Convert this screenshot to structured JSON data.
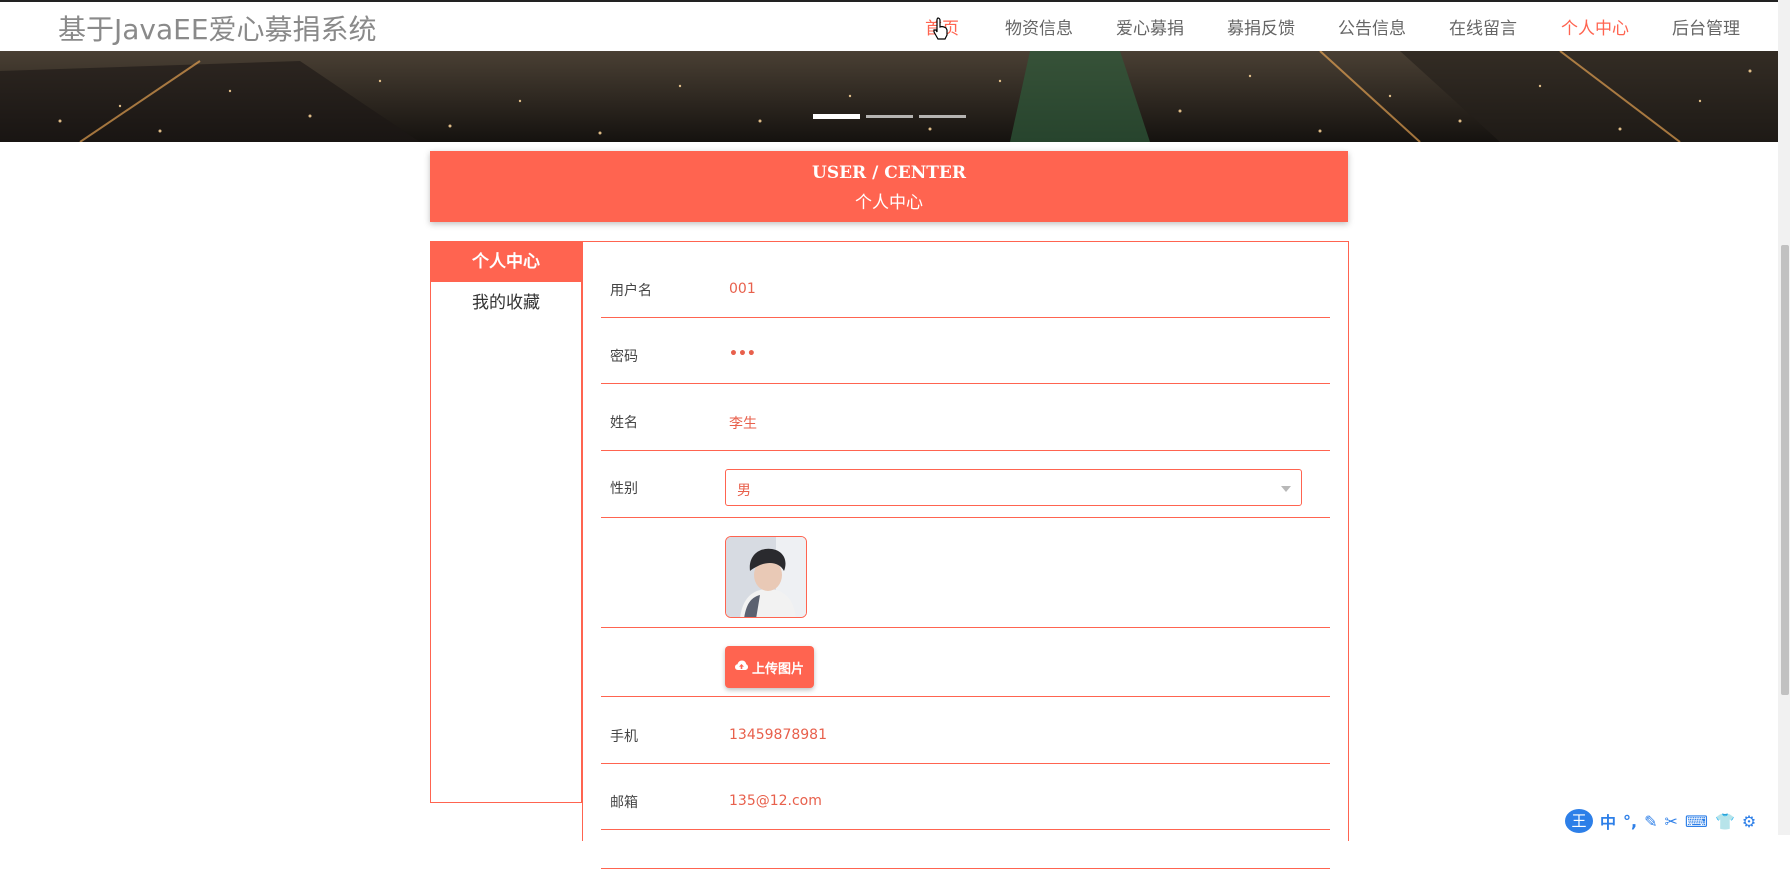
{
  "site_title": "基于JavaEE爱心募捐系统",
  "nav": [
    {
      "label": "首页"
    },
    {
      "label": "物资信息"
    },
    {
      "label": "爱心募捐"
    },
    {
      "label": "募捐反馈"
    },
    {
      "label": "公告信息"
    },
    {
      "label": "在线留言"
    },
    {
      "label": "个人中心"
    },
    {
      "label": "后台管理"
    }
  ],
  "header": {
    "en": "USER / CENTER",
    "cn": "个人中心"
  },
  "sidebar": [
    {
      "label": "个人中心"
    },
    {
      "label": "我的收藏"
    }
  ],
  "form": {
    "username": {
      "label": "用户名",
      "value": "001"
    },
    "password": {
      "label": "密码",
      "value": "•••"
    },
    "name": {
      "label": "姓名",
      "value": "李生"
    },
    "gender": {
      "label": "性别",
      "value": "男"
    },
    "upload_label": "上传图片",
    "phone": {
      "label": "手机",
      "value": "13459878981"
    },
    "email": {
      "label": "邮箱",
      "value": "135@12.com"
    }
  },
  "ime": {
    "logo": "王",
    "items": [
      "中",
      "°,",
      "✎",
      "✂",
      "⌨",
      "👕",
      "⚙"
    ]
  },
  "colors": {
    "accent": "#ff6450",
    "nav_text": "#666666"
  }
}
